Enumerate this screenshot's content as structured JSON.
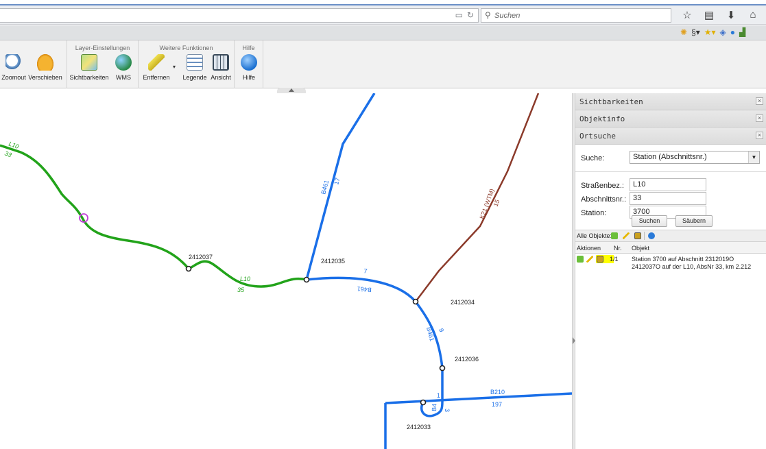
{
  "browser": {
    "search_placeholder": "Suchen",
    "nav_icons": [
      "star-icon",
      "reading-list-icon",
      "download-icon",
      "home-icon",
      "menu-icon"
    ]
  },
  "ribbon": {
    "groups": [
      {
        "title": "",
        "tools": [
          {
            "label": "Zoomout",
            "icon": "zoom-out-icon"
          },
          {
            "label": "Verschieben",
            "icon": "hand-pan-icon"
          }
        ]
      },
      {
        "title": "Layer-Einstellungen",
        "tools": [
          {
            "label": "Sichtbarkeiten",
            "icon": "map-visibility-icon"
          },
          {
            "label": "WMS",
            "icon": "globe-add-icon"
          }
        ]
      },
      {
        "title": "Weitere Funktionen",
        "tools": [
          {
            "label": "Entfernen",
            "icon": "eraser-icon"
          },
          {
            "label": "Legende",
            "icon": "legend-icon"
          },
          {
            "label": "Ansicht",
            "icon": "view-icon"
          }
        ]
      },
      {
        "title": "Hilfe",
        "tools": [
          {
            "label": "Hilfe",
            "icon": "help-icon"
          }
        ]
      }
    ]
  },
  "map": {
    "labels": {
      "node_2412037": "2412037",
      "node_2412035": "2412035",
      "node_2412034": "2412034",
      "node_2412036": "2412036",
      "node_2412033": "2412033",
      "l10_top": "L10",
      "l10_top_num": "33",
      "l10_mid": "L10",
      "l10_mid_num": "35",
      "b461_upper": "B461",
      "b461_upper_num": "17",
      "b461_curve": "B461",
      "b461_curve_num": "7",
      "b461_right": "B461",
      "b461_right_num": "9",
      "b461_bottom": "B4",
      "b461_bottom_num": "1",
      "b461_bottom_num2": "3",
      "b210": "B210",
      "b210_num": "197",
      "k21": "K21 (WTM)",
      "k21_num": "15"
    },
    "colors": {
      "l10": "#22a31a",
      "b461": "#1a6fe8",
      "k21": "#8b3a2a",
      "marker": "#c23fd8"
    }
  },
  "panel": {
    "sections": [
      "Sichtbarkeiten",
      "Objektinfo",
      "Ortsuche"
    ],
    "close_symbol": "×",
    "form": {
      "suche_label": "Suche:",
      "suche_value": "Station (Abschnittsnr.)",
      "strasse_label": "Straßenbez.:",
      "strasse_value": "L10",
      "abschnitt_label": "Abschnittsnr.:",
      "abschnitt_value": "33",
      "station_label": "Station:",
      "station_value": "3700",
      "btn_suchen": "Suchen",
      "btn_saeubern": "Säubern"
    },
    "results": {
      "bar_label": "Alle Objekte:",
      "col_aktionen": "Aktionen",
      "col_nr": "Nr.",
      "col_objekt": "Objekt",
      "row_nr": "1/1",
      "row_objekt": "Station 3700 auf Abschnitt 2312019O 2412037O auf der L10, AbsNr 33, km 2.212"
    }
  }
}
